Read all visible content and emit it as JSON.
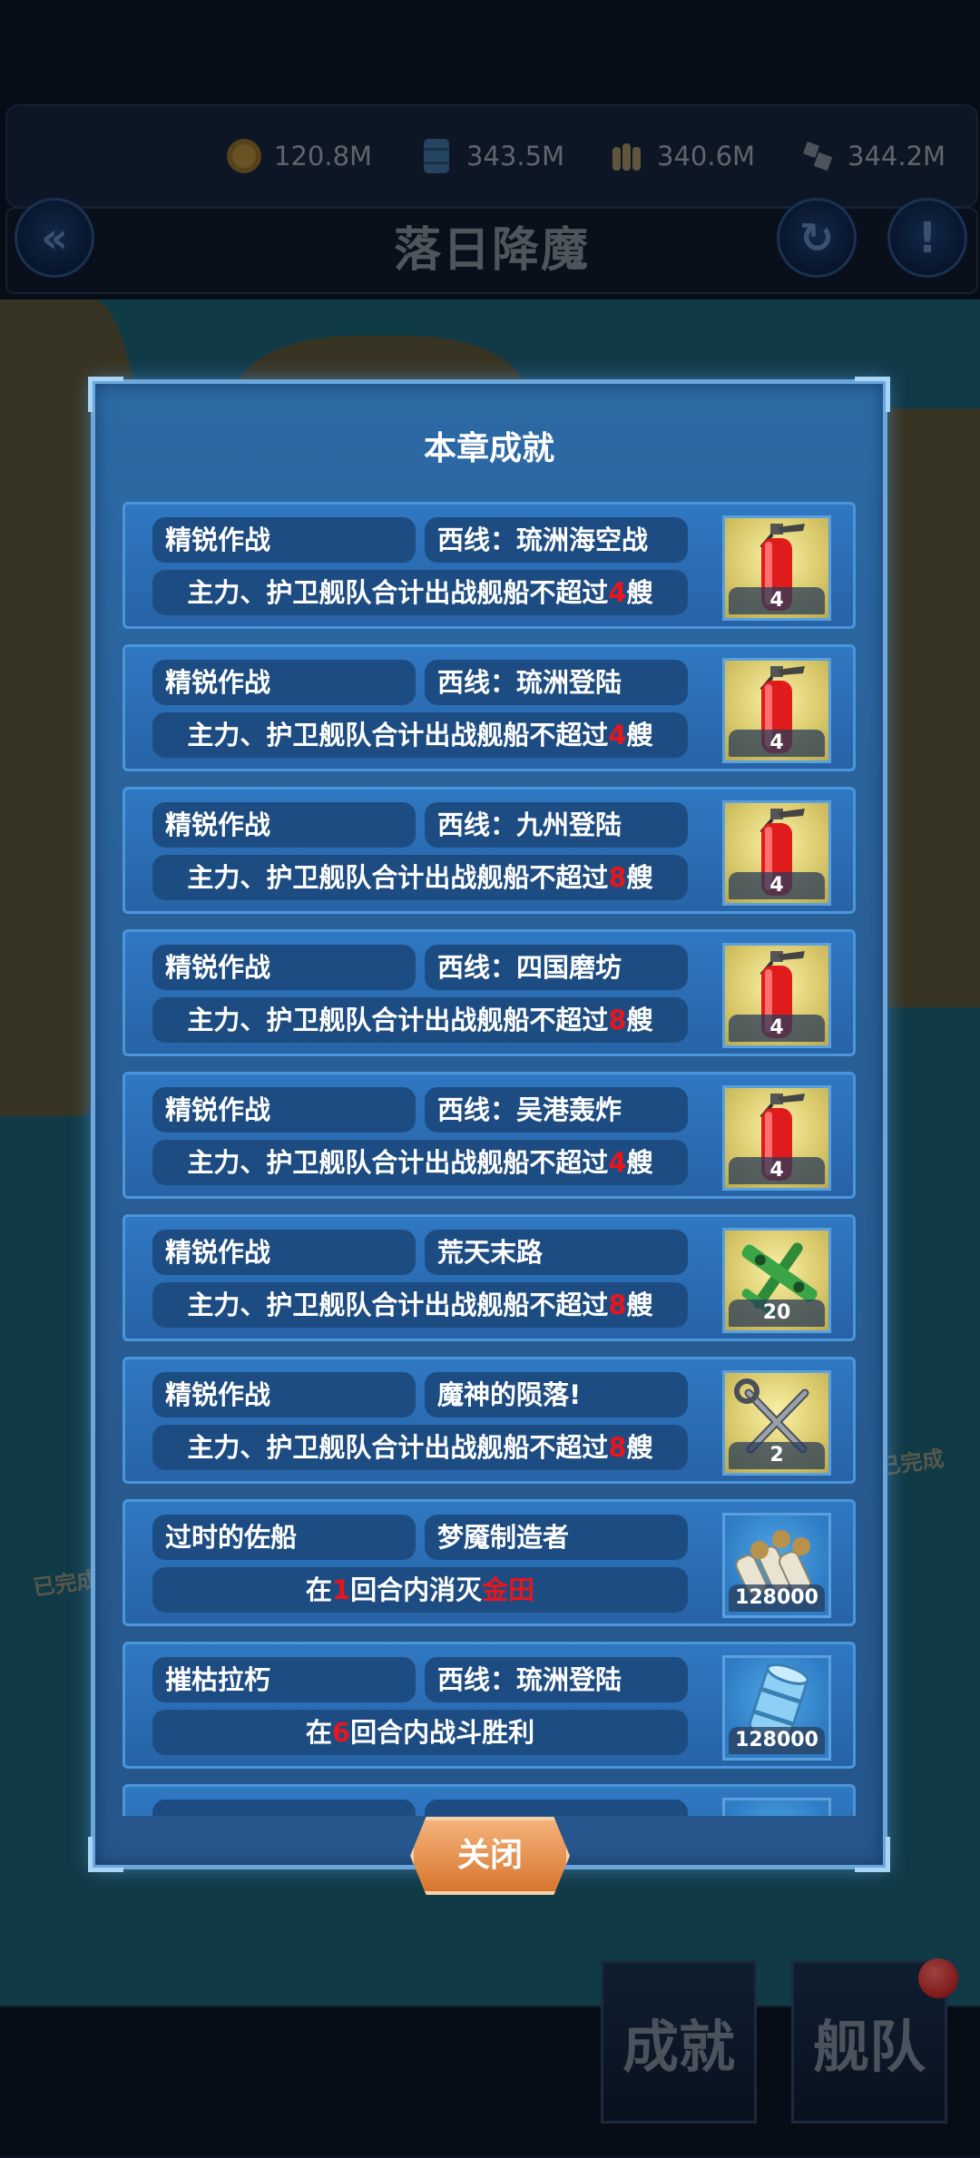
{
  "resources": [
    {
      "icon": "coin-icon",
      "value": "120.8M"
    },
    {
      "icon": "oil-barrel-icon",
      "value": "343.5M"
    },
    {
      "icon": "ammo-icon",
      "value": "340.6M"
    },
    {
      "icon": "steel-icon",
      "value": "344.2M"
    }
  ],
  "header": {
    "title": "落日降魔",
    "back_icon": "double-chevron-left-icon",
    "refresh_icon": "refresh-icon",
    "info_icon": "exclamation-icon"
  },
  "map": {
    "done_badge": "已完成"
  },
  "bottom": {
    "achievement_label": "成就",
    "fleet_label": "舰队"
  },
  "modal": {
    "title": "本章成就",
    "close_label": "关闭",
    "achievements": [
      {
        "name": "精锐作战",
        "stage": "西线：琉洲海空战",
        "desc_pre": "主力、护卫舰队合计出战舰船不超过",
        "desc_hl": "4",
        "desc_post": "艘",
        "reward_icon": "fire-extinguisher-icon",
        "reward_qty": "4"
      },
      {
        "name": "精锐作战",
        "stage": "西线：琉洲登陆",
        "desc_pre": "主力、护卫舰队合计出战舰船不超过",
        "desc_hl": "4",
        "desc_post": "艘",
        "reward_icon": "fire-extinguisher-icon",
        "reward_qty": "4"
      },
      {
        "name": "精锐作战",
        "stage": "西线：九州登陆",
        "desc_pre": "主力、护卫舰队合计出战舰船不超过",
        "desc_hl": "8",
        "desc_post": "艘",
        "reward_icon": "fire-extinguisher-icon",
        "reward_qty": "4"
      },
      {
        "name": "精锐作战",
        "stage": "西线：四国磨坊",
        "desc_pre": "主力、护卫舰队合计出战舰船不超过",
        "desc_hl": "8",
        "desc_post": "艘",
        "reward_icon": "fire-extinguisher-icon",
        "reward_qty": "4"
      },
      {
        "name": "精锐作战",
        "stage": "西线：吴港轰炸",
        "desc_pre": "主力、护卫舰队合计出战舰船不超过",
        "desc_hl": "4",
        "desc_post": "艘",
        "reward_icon": "fire-extinguisher-icon",
        "reward_qty": "4"
      },
      {
        "name": "精锐作战",
        "stage": "荒天末路",
        "desc_pre": "主力、护卫舰队合计出战舰船不超过",
        "desc_hl": "8",
        "desc_post": "艘",
        "reward_icon": "airplane-icon",
        "reward_qty": "20"
      },
      {
        "name": "精锐作战",
        "stage": "魔神的陨落!",
        "desc_pre": "主力、护卫舰队合计出战舰船不超过",
        "desc_hl": "8",
        "desc_post": "艘",
        "reward_icon": "wrench-icon",
        "reward_qty": "2"
      },
      {
        "name": "过时的佐船",
        "stage": "梦魇制造者",
        "desc_pre": "在",
        "desc_hl": "1",
        "desc_post": "回合内消灭",
        "desc_hl2": "金田",
        "reward_icon": "ammo-icon",
        "reward_qty": "128000"
      },
      {
        "name": "摧枯拉朽",
        "stage": "西线：琉洲登陆",
        "desc_pre": "在",
        "desc_hl": "6",
        "desc_post": "回合内战斗胜利",
        "reward_icon": "oil-barrel-icon",
        "reward_qty": "128000"
      }
    ]
  },
  "colors": {
    "accent_red": "#e7161c",
    "panel_blue": "#2a64a2",
    "close_orange": "#e08a44"
  }
}
